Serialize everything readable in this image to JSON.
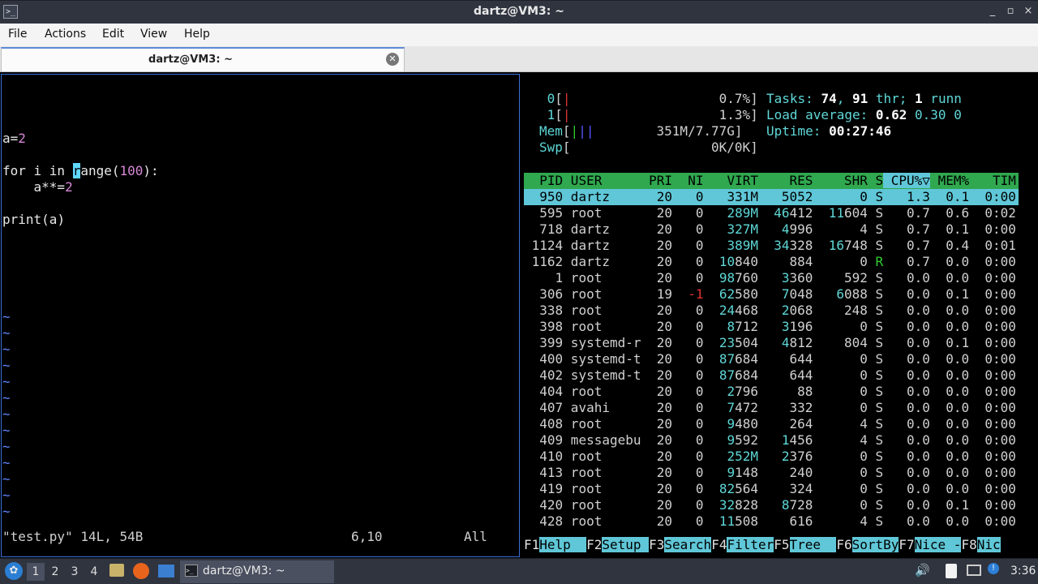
{
  "window": {
    "title": "dartz@VM3: ~",
    "controls": [
      "_",
      "▫",
      "×"
    ]
  },
  "menubar": {
    "items": [
      "File",
      "Actions",
      "Edit",
      "View",
      "Help"
    ]
  },
  "tab": {
    "title": "dartz@VM3: ~"
  },
  "vim": {
    "lines": [
      {
        "row": 3,
        "parts": [
          [
            "a=",
            "kw"
          ],
          [
            "2",
            "num"
          ]
        ]
      },
      {
        "row": 5,
        "parts": [
          [
            "for i in ",
            "kw"
          ],
          [
            "r",
            "cursor"
          ],
          [
            "ange",
            "kw"
          ],
          [
            "(",
            "kw"
          ],
          [
            "100",
            "num"
          ],
          [
            "):",
            "kw"
          ]
        ]
      },
      {
        "row": 6,
        "parts": [
          [
            "    a**=",
            "kw"
          ],
          [
            "2",
            "num"
          ]
        ]
      },
      {
        "row": 8,
        "parts": [
          [
            "print",
            "kw"
          ],
          [
            "(a)",
            "kw"
          ]
        ]
      }
    ],
    "tilde_rows": [
      14,
      15,
      16,
      17,
      18,
      19,
      20,
      21,
      22,
      23,
      24,
      25,
      26
    ],
    "status_file": "\"test.py\" 14L, 54B",
    "status_pos": "6,10",
    "status_all": "All"
  },
  "htop": {
    "cpu0": {
      "label": "0",
      "pct": "0.7%"
    },
    "cpu1": {
      "label": "1",
      "pct": "1.3%"
    },
    "mem": {
      "label": "Mem",
      "val": "351M/7.77G"
    },
    "swp": {
      "label": "Swp",
      "val": "0K/0K"
    },
    "tasks": {
      "label": "Tasks:",
      "count": "74",
      "sep": ",",
      "threads": "91",
      "thr": "thr;",
      "running": "1",
      "runn": "runn"
    },
    "load": {
      "label": "Load average:",
      "v1": "0.62",
      "v2": "0.30",
      "v3": "0"
    },
    "uptime": {
      "label": "Uptime:",
      "value": "00:27:46"
    },
    "header": [
      "PID",
      "USER",
      "PRI",
      "NI",
      "VIRT",
      "RES",
      "SHR",
      "S",
      "CPU%▽",
      "MEM%",
      "TIM"
    ],
    "rows": [
      [
        "950",
        "dartz",
        "20",
        "0",
        "331M",
        "5052",
        "0",
        "S",
        "1.3",
        "0.1",
        "0:00"
      ],
      [
        "595",
        "root",
        "20",
        "0",
        "289M",
        "46412",
        "11604",
        "S",
        "0.7",
        "0.6",
        "0:02"
      ],
      [
        "718",
        "dartz",
        "20",
        "0",
        "327M",
        "4996",
        "4",
        "S",
        "0.7",
        "0.1",
        "0:00"
      ],
      [
        "1124",
        "dartz",
        "20",
        "0",
        "389M",
        "34328",
        "16748",
        "S",
        "0.7",
        "0.4",
        "0:01"
      ],
      [
        "1162",
        "dartz",
        "20",
        "0",
        "10840",
        "884",
        "0",
        "R",
        "0.7",
        "0.0",
        "0:00"
      ],
      [
        "1",
        "root",
        "20",
        "0",
        "98760",
        "3360",
        "592",
        "S",
        "0.0",
        "0.0",
        "0:00"
      ],
      [
        "306",
        "root",
        "19",
        "-1",
        "62580",
        "7048",
        "6088",
        "S",
        "0.0",
        "0.1",
        "0:00"
      ],
      [
        "338",
        "root",
        "20",
        "0",
        "24468",
        "2068",
        "248",
        "S",
        "0.0",
        "0.0",
        "0:00"
      ],
      [
        "398",
        "root",
        "20",
        "0",
        "8712",
        "3196",
        "0",
        "S",
        "0.0",
        "0.0",
        "0:00"
      ],
      [
        "399",
        "systemd-r",
        "20",
        "0",
        "23504",
        "4812",
        "804",
        "S",
        "0.0",
        "0.1",
        "0:00"
      ],
      [
        "400",
        "systemd-t",
        "20",
        "0",
        "87684",
        "644",
        "0",
        "S",
        "0.0",
        "0.0",
        "0:00"
      ],
      [
        "402",
        "systemd-t",
        "20",
        "0",
        "87684",
        "644",
        "0",
        "S",
        "0.0",
        "0.0",
        "0:00"
      ],
      [
        "404",
        "root",
        "20",
        "0",
        "2796",
        "88",
        "0",
        "S",
        "0.0",
        "0.0",
        "0:00"
      ],
      [
        "407",
        "avahi",
        "20",
        "0",
        "7472",
        "332",
        "0",
        "S",
        "0.0",
        "0.0",
        "0:00"
      ],
      [
        "408",
        "root",
        "20",
        "0",
        "9480",
        "264",
        "4",
        "S",
        "0.0",
        "0.0",
        "0:00"
      ],
      [
        "409",
        "messagebu",
        "20",
        "0",
        "9592",
        "1456",
        "4",
        "S",
        "0.0",
        "0.0",
        "0:00"
      ],
      [
        "410",
        "root",
        "20",
        "0",
        "252M",
        "2376",
        "0",
        "S",
        "0.0",
        "0.0",
        "0:00"
      ],
      [
        "413",
        "root",
        "20",
        "0",
        "9148",
        "240",
        "0",
        "S",
        "0.0",
        "0.0",
        "0:00"
      ],
      [
        "419",
        "root",
        "20",
        "0",
        "82564",
        "324",
        "0",
        "S",
        "0.0",
        "0.0",
        "0:00"
      ],
      [
        "420",
        "root",
        "20",
        "0",
        "32828",
        "8728",
        "0",
        "S",
        "0.0",
        "0.1",
        "0:00"
      ],
      [
        "428",
        "root",
        "20",
        "0",
        "11508",
        "616",
        "4",
        "S",
        "0.0",
        "0.0",
        "0:00"
      ]
    ],
    "fkeys": [
      [
        "F1",
        "Help  "
      ],
      [
        "F2",
        "Setup "
      ],
      [
        "F3",
        "Search"
      ],
      [
        "F4",
        "Filter"
      ],
      [
        "F5",
        "Tree  "
      ],
      [
        "F6",
        "SortBy"
      ],
      [
        "F7",
        "Nice -"
      ],
      [
        "F8",
        "Nic"
      ]
    ]
  },
  "taskbar": {
    "desktops": [
      "1",
      "2",
      "3",
      "4"
    ],
    "task": "dartz@VM3: ~",
    "clock": "3:36"
  }
}
